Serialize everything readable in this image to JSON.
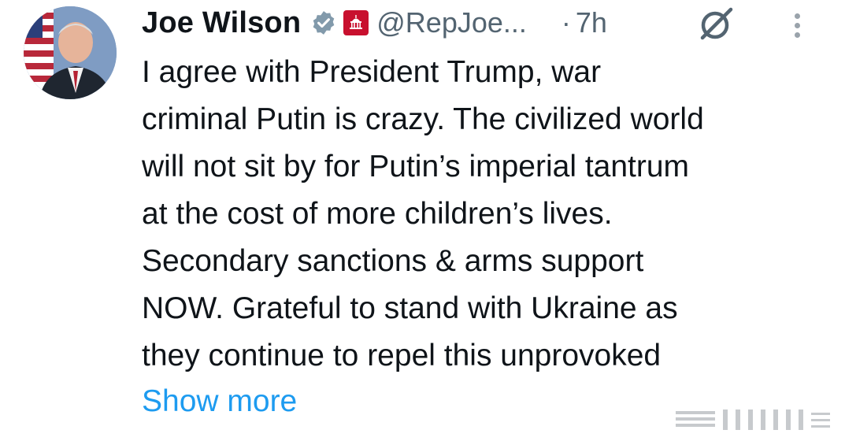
{
  "author": {
    "name": "Joe Wilson",
    "handle": "@RepJoe...",
    "separator": "·",
    "time": "7h",
    "verified_color": "#829aab",
    "affiliation_color": "#c8102e"
  },
  "tweet": {
    "lines": [
      "I agree with President Trump, war",
      "criminal Putin is crazy. The civilized world",
      "will not sit by for Putin’s imperial tantrum",
      "at the cost of more children’s lives.",
      "Secondary sanctions & arms support",
      "NOW. Grateful to stand with Ukraine as",
      "they continue to repel this unprovoked"
    ],
    "show_more": "Show more",
    "link_color": "#1d9bf0"
  },
  "icons": {
    "verified": "verified-badge-icon",
    "affiliation": "capitol-affiliation-icon",
    "grok": "grok-icon",
    "more": "more-options-icon"
  }
}
